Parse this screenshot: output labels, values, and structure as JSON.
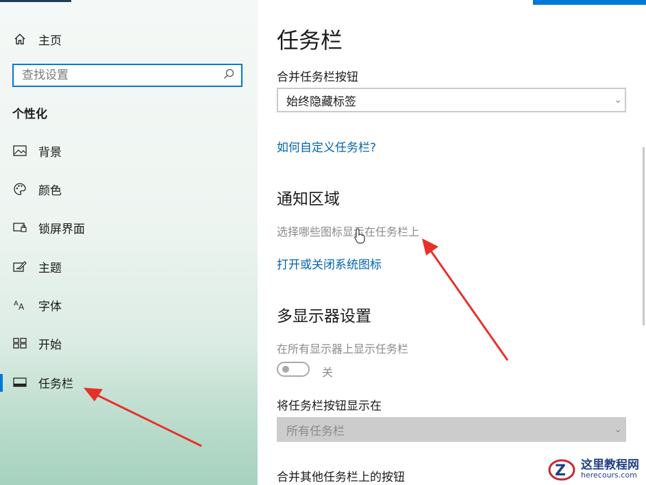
{
  "sidebar": {
    "home_label": "主页",
    "search_placeholder": "查找设置",
    "section_title": "个性化",
    "items": [
      {
        "label": "背景",
        "icon": "picture-icon"
      },
      {
        "label": "颜色",
        "icon": "palette-icon"
      },
      {
        "label": "锁屏界面",
        "icon": "lock-screen-icon"
      },
      {
        "label": "主题",
        "icon": "theme-brush-icon"
      },
      {
        "label": "字体",
        "icon": "font-icon"
      },
      {
        "label": "开始",
        "icon": "start-grid-icon"
      },
      {
        "label": "任务栏",
        "icon": "taskbar-icon",
        "active": true
      }
    ]
  },
  "main": {
    "title": "任务栏",
    "combine_label": "合并任务栏按钮",
    "combine_value": "始终隐藏标签",
    "customize_link": "如何自定义任务栏?",
    "notify_heading": "通知区域",
    "notify_choose": "选择哪些图标显示在任务栏上",
    "notify_system_link": "打开或关闭系统图标",
    "multi_heading": "多显示器设置",
    "multi_show_label": "在所有显示器上显示任务栏",
    "multi_toggle_state": "关",
    "show_buttons_label": "将任务栏按钮显示在",
    "show_buttons_value": "所有任务栏",
    "combine_other_label": "合并其他任务栏上的按钮"
  },
  "watermark": {
    "title": "这里教程网",
    "url": "herecours.com"
  },
  "colors": {
    "accent": "#0078d7",
    "link": "#0063b1",
    "annotation_arrow": "#e8302a"
  }
}
